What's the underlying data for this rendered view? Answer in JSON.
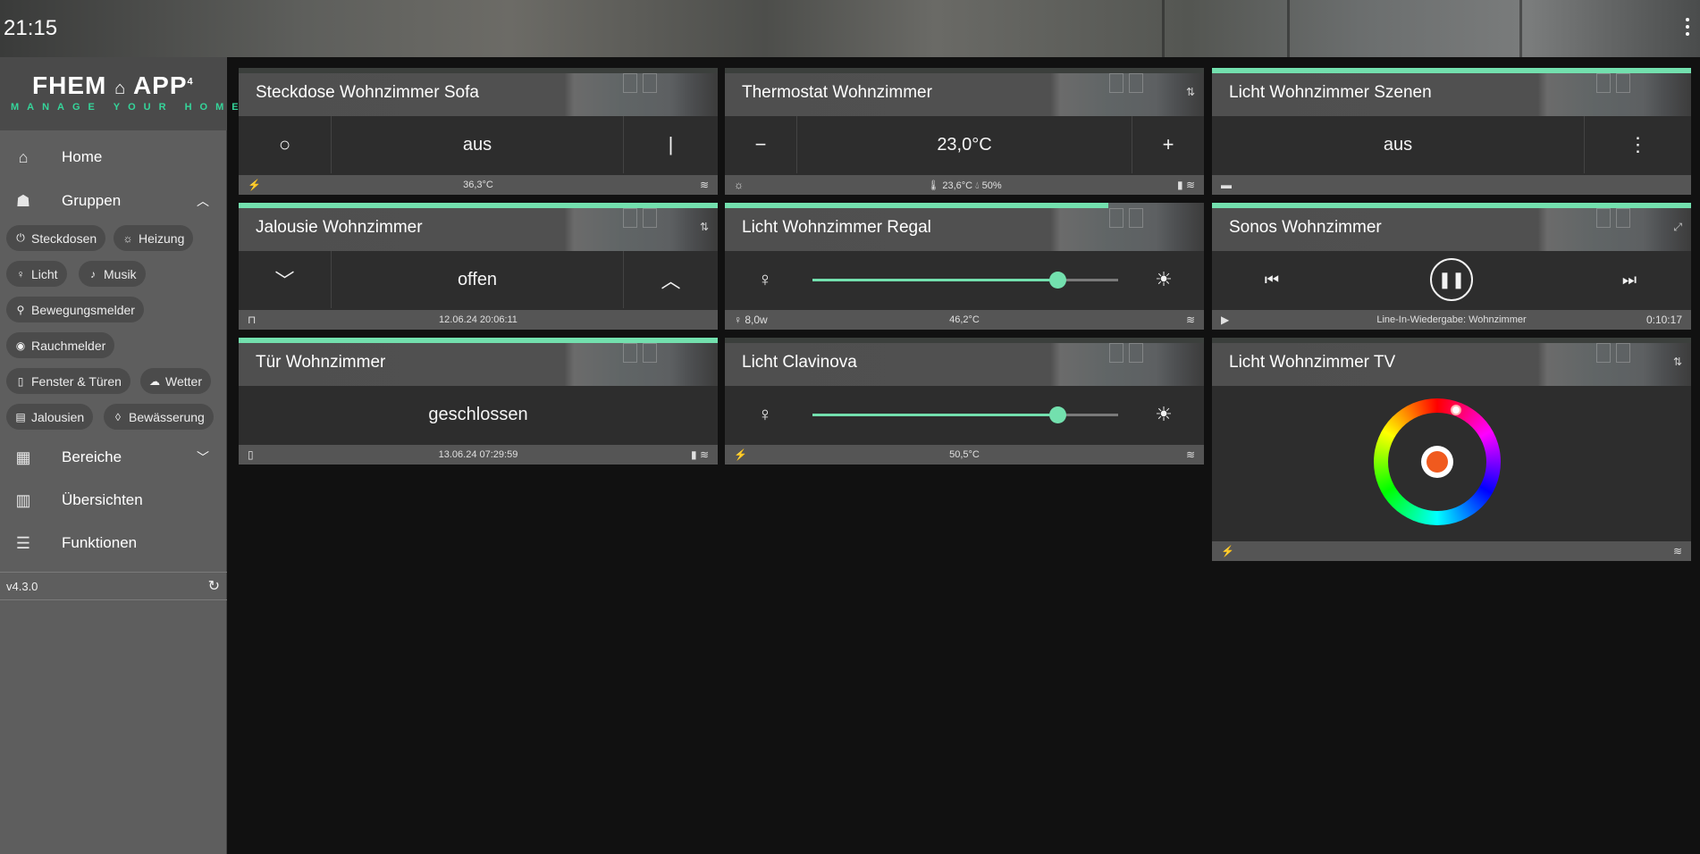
{
  "topbar": {
    "clock": "21:15"
  },
  "sidebar": {
    "logo_main": "FHEM",
    "logo_app": "APP",
    "logo_version": "4",
    "logo_sub": "MANAGE YOUR HOME",
    "nav": {
      "home": "Home",
      "groups": "Gruppen",
      "areas": "Bereiche",
      "overviews": "Übersichten",
      "functions": "Funktionen"
    },
    "chips": [
      "Steckdosen",
      "Heizung",
      "Licht",
      "Musik",
      "Bewegungsmelder",
      "Rauchmelder",
      "Fenster & Türen",
      "Wetter",
      "Jalousien",
      "Bewässerung"
    ],
    "version": "v4.3.0"
  },
  "tiles": {
    "socket": {
      "title": "Steckdose Wohnzimmer Sofa",
      "value": "aus",
      "footer": "36,3°C"
    },
    "thermostat": {
      "title": "Thermostat Wohnzimmer",
      "value": "23,0°C",
      "footer_temp": "23,6°C",
      "footer_hum": "50%"
    },
    "scenes": {
      "title": "Licht Wohnzimmer Szenen",
      "value": "aus"
    },
    "blinds": {
      "title": "Jalousie Wohnzimmer",
      "value": "offen",
      "footer": "12.06.24 20:06:11"
    },
    "shelf": {
      "title": "Licht Wohnzimmer Regal",
      "level": 0.8,
      "footer_power": "8,0w",
      "footer": "46,2°C"
    },
    "sonos": {
      "title": "Sonos Wohnzimmer",
      "footer": "Line-In-Wiedergabe: Wohnzimmer",
      "time": "0:10:17"
    },
    "door": {
      "title": "Tür Wohnzimmer",
      "value": "geschlossen",
      "footer": "13.06.24 07:29:59"
    },
    "clavinova": {
      "title": "Licht Clavinova",
      "level": 0.8,
      "footer": "50,5°C"
    },
    "tv": {
      "title": "Licht Wohnzimmer TV",
      "color": "#f05a1e"
    }
  },
  "colors": {
    "accent": "#73e0ae",
    "logo_green": "#35d59a",
    "background": "#111111"
  }
}
